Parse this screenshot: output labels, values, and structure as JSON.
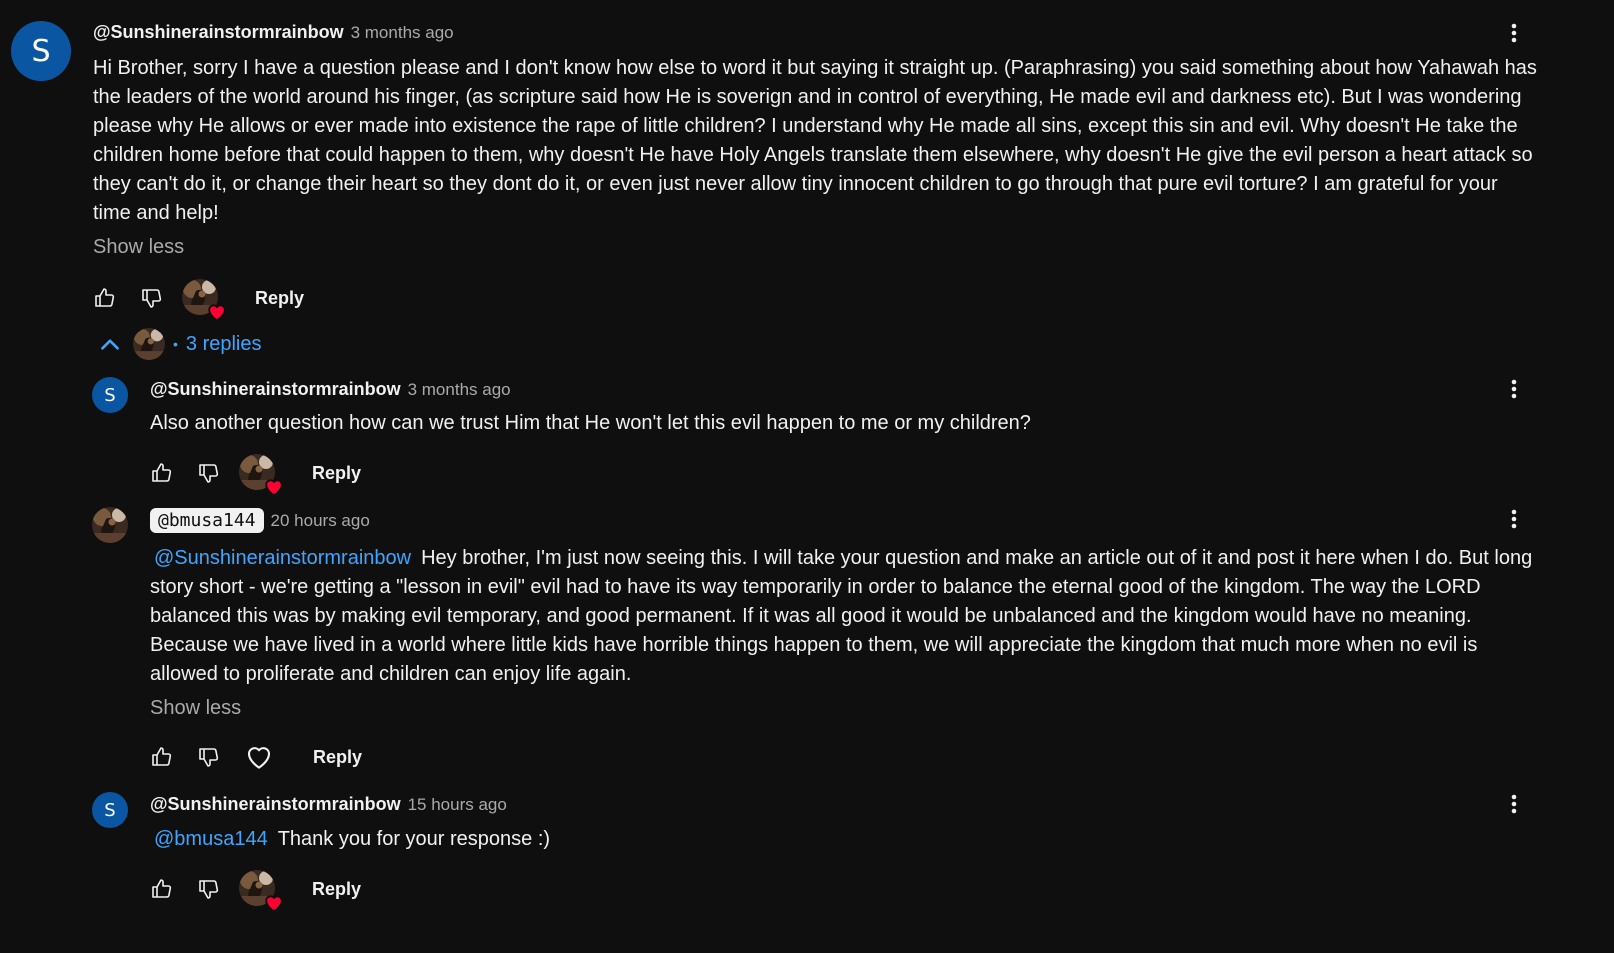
{
  "top_comment": {
    "author": "@Sunshinerainstormrainbow",
    "avatar_letter": "S",
    "timestamp": "3 months ago",
    "lines": [
      "Hi Brother, sorry I have a question please and I don't know how else to word it but saying it straight up. (Paraphrasing) you said something about how Yahawah has",
      "the leaders of the world around his finger, (as scripture said how He is soverign and in control of everything, He made evil and darkness etc). But I was wondering",
      "please why He allows or ever made into existence the rape of little children? I understand why He made all sins, except this sin and evil. Why doesn't He take the",
      "children home before that could happen to them, why doesn't He have Holy Angels translate them elsewhere, why doesn't He give the evil person a heart attack so",
      "they can't do it, or change their heart so they dont do it, or even just never allow tiny innocent children to go through that pure evil torture? I am grateful for your",
      "time and help!"
    ],
    "show_less": "Show less",
    "reply_label": "Reply"
  },
  "replies_toggle": {
    "label": "3 replies",
    "separator": "•"
  },
  "replies": [
    {
      "author": "@Sunshinerainstormrainbow",
      "avatar_letter": "S",
      "timestamp": "3 months ago",
      "text": "Also another question how can we trust Him that He won't let this evil happen to me or my children?",
      "reply_label": "Reply"
    },
    {
      "author": "@bmusa144",
      "timestamp": "20 hours ago",
      "mention": "@Sunshinerainstormrainbow",
      "lines": [
        "Hey brother, I'm just now seeing this. I will take your question and make an article out of it and post it here when I do. But long",
        "story short - we're getting a \"lesson in evil\" evil had to have its way temporarily in order to balance the eternal good of the kingdom. The way the LORD",
        "balanced this was by making evil temporary, and good permanent. If it was all good it would be unbalanced and the kingdom would have no meaning.",
        "Because we have lived in a world where little kids have horrible things happen to them, we will appreciate the kingdom that much more when no evil is",
        "allowed to proliferate and children can enjoy life again."
      ],
      "show_less": "Show less",
      "reply_label": "Reply"
    },
    {
      "author": "@Sunshinerainstormrainbow",
      "avatar_letter": "S",
      "timestamp": "15 hours ago",
      "mention": "@bmusa144",
      "text": "Thank you for your response :)",
      "reply_label": "Reply"
    }
  ],
  "colors": {
    "background": "#0f0f0f",
    "text": "#f1f1f1",
    "secondary": "#aaaaaa",
    "link": "#3ea6ff",
    "avatar": "#0b56a3",
    "heart": "#ff0033"
  },
  "icons": {
    "like": "thumbs-up-icon",
    "dislike": "thumbs-down-icon",
    "heart": "heart-icon",
    "more": "more-vert-icon",
    "collapse": "chevron-up-icon"
  }
}
